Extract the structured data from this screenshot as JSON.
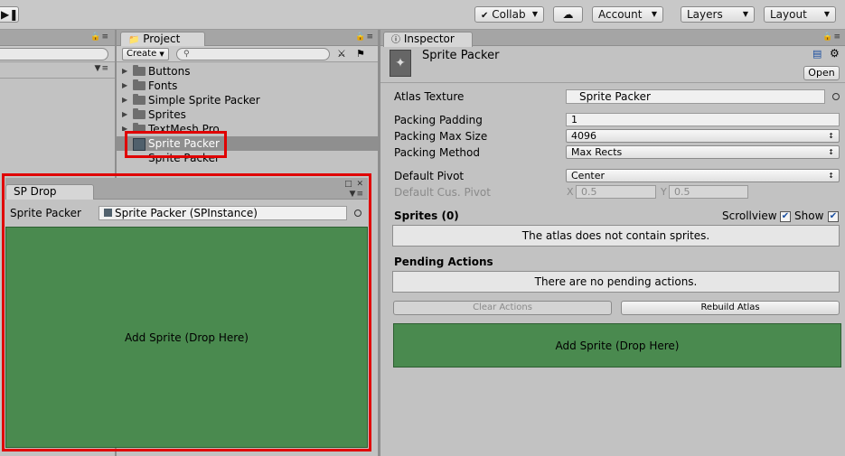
{
  "toolbar": {
    "play_icon": "step-icon",
    "collab": "Collab",
    "cloud_icon": "cloud-icon",
    "account": "Account",
    "layers": "Layers",
    "layout": "Layout"
  },
  "project": {
    "tab": "Project",
    "create": "Create",
    "tree": [
      {
        "label": "Buttons",
        "kind": "folder"
      },
      {
        "label": "Fonts",
        "kind": "folder"
      },
      {
        "label": "Simple Sprite Packer",
        "kind": "folder"
      },
      {
        "label": "Sprites",
        "kind": "folder"
      },
      {
        "label": "TextMesh Pro",
        "kind": "folder"
      },
      {
        "label": "Sprite Packer",
        "kind": "asset",
        "selected": true
      },
      {
        "label": "Sprite Packer",
        "kind": "asset"
      }
    ]
  },
  "spdrop": {
    "tab": "SP Drop",
    "field_label": "Sprite Packer",
    "field_value": "Sprite Packer (SPInstance)",
    "drop_text": "Add Sprite (Drop Here)"
  },
  "inspector": {
    "tab": "Inspector",
    "object_name": "Sprite Packer",
    "open_button": "Open",
    "atlas_texture": {
      "label": "Atlas Texture",
      "value": "Sprite Packer"
    },
    "packing_padding": {
      "label": "Packing Padding",
      "value": "1"
    },
    "packing_max_size": {
      "label": "Packing Max Size",
      "value": "4096"
    },
    "packing_method": {
      "label": "Packing Method",
      "value": "Max Rects"
    },
    "default_pivot": {
      "label": "Default Pivot",
      "value": "Center"
    },
    "default_cus_pivot": {
      "label": "Default Cus. Pivot",
      "x_label": "X",
      "x_value": "0.5",
      "y_label": "Y",
      "y_value": "0.5"
    },
    "sprites_header": "Sprites (0)",
    "scrollview_label": "Scrollview",
    "show_label": "Show",
    "no_sprites_msg": "The atlas does not contain sprites.",
    "pending_header": "Pending Actions",
    "no_pending_msg": "There are no pending actions.",
    "clear_actions": "Clear Actions",
    "rebuild_atlas": "Rebuild Atlas",
    "drop_text": "Add Sprite (Drop Here)"
  },
  "colors": {
    "highlight_border": "#e00000",
    "drop_zone": "#4a8a4f"
  }
}
